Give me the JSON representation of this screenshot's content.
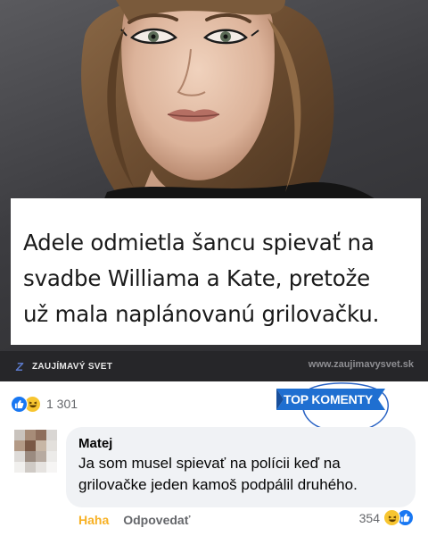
{
  "post": {
    "caption_lines": [
      "Adele odmietla šancu spievať na",
      "svadbe Williama a Kate, pretože",
      "už mala naplánovanú grilovačku."
    ]
  },
  "brand": {
    "logo_glyph": "Z",
    "name": "ZAUJÍMAVÝ SVET",
    "url": "www.zaujimavysvet.sk"
  },
  "reactions": {
    "icons": [
      "like-icon",
      "haha-icon"
    ],
    "count": "1 301"
  },
  "badge": {
    "label": "TOP KOMENTY"
  },
  "comment": {
    "author": "Matej",
    "text_lines": [
      "Ja som musel spievať na polícii keď na",
      "grilovačke jeden kamoš podpálil druhého."
    ],
    "actions": {
      "reaction": "Haha",
      "reply": "Odpovedať"
    },
    "reaction_count": "354",
    "reaction_icons": [
      "haha-icon",
      "like-icon"
    ]
  },
  "colors": {
    "facebook_blue": "#1877f2",
    "haha_yellow": "#f7c530",
    "badge_blue": "#1f6fd1",
    "bubble_gray": "#f0f2f5"
  }
}
